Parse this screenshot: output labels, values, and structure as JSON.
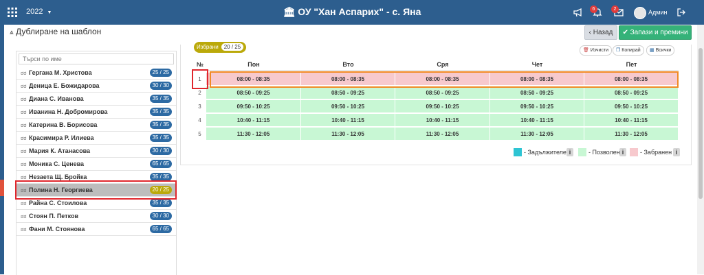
{
  "header": {
    "year": "2022",
    "school": "ОУ \"Хан Аспарих\" - с. Яна",
    "notif_count": "6",
    "msg_count": "2",
    "user": "Админ"
  },
  "page": {
    "title": "Дублиране на шаблон",
    "back_label": "Назад",
    "save_label": "Запази и премини"
  },
  "search": {
    "placeholder": "Търси по име"
  },
  "teachers": [
    {
      "name": "Гергана М. Христова",
      "hours": "25 / 25"
    },
    {
      "name": "Деница Е. Божидарова",
      "hours": "30 / 30"
    },
    {
      "name": "Диана С. Иванова",
      "hours": "35 / 35"
    },
    {
      "name": "Иванина Н. Добромирова",
      "hours": "35 / 35"
    },
    {
      "name": "Катерина В. Борисова",
      "hours": "35 / 35"
    },
    {
      "name": "Красимира Р. Илиева",
      "hours": "35 / 35"
    },
    {
      "name": "Мария К. Атанасова",
      "hours": "30 / 30"
    },
    {
      "name": "Моника С. Ценева",
      "hours": "65 / 65"
    },
    {
      "name": "Незаета Щ. Бройка",
      "hours": "35 / 35"
    },
    {
      "name": "Полина Н. Георгиева",
      "hours": "20 / 25"
    },
    {
      "name": "Райна С. Стоилова",
      "hours": "35 / 35"
    },
    {
      "name": "Стоян П. Петков",
      "hours": "30 / 30"
    },
    {
      "name": "Фани М. Стоянова",
      "hours": "65 / 65"
    }
  ],
  "selected": {
    "label": "Избрани",
    "count": "20 / 25"
  },
  "tools": {
    "clear": "Изчисти",
    "copy": "Копирай",
    "all": "Всички"
  },
  "table": {
    "num_header": "№",
    "days": [
      "Пон",
      "Вто",
      "Сря",
      "Чет",
      "Пет"
    ],
    "rows": [
      {
        "num": "1",
        "time": "08:00 - 08:35",
        "status": "forbidden"
      },
      {
        "num": "2",
        "time": "08:50 - 09:25",
        "status": "allowed"
      },
      {
        "num": "3",
        "time": "09:50 - 10:25",
        "status": "allowed"
      },
      {
        "num": "4",
        "time": "10:40 - 11:15",
        "status": "allowed"
      },
      {
        "num": "5",
        "time": "11:30 - 12:05",
        "status": "allowed"
      }
    ]
  },
  "legend": {
    "required": "- Задължителен",
    "allowed": "- Позволен",
    "forbidden": "- Забранен",
    "info": "i"
  },
  "colors": {
    "header_bg": "#2d5e8e",
    "allowed": "#c8f7d4",
    "forbidden": "#f7c9cd",
    "required": "#2ec4d3",
    "accent_selected": "#bba90a",
    "save_button": "#35b279"
  }
}
